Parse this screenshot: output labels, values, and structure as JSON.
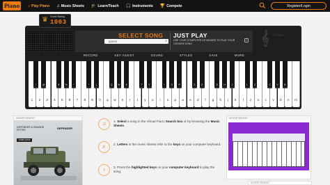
{
  "header": {
    "logo_text": "Piano",
    "nav": [
      {
        "label": "Play Piano",
        "icon": "piano-icon",
        "glyph": "♪",
        "active": true
      },
      {
        "label": "Music Sheets",
        "icon": "music-note-icon",
        "glyph": "♫",
        "active": false
      },
      {
        "label": "Learn/Teach",
        "icon": "graduation-cap-icon",
        "glyph": "🎓",
        "active": false
      },
      {
        "label": "Instruments",
        "icon": "headphones-icon",
        "glyph": "🎧",
        "active": false
      },
      {
        "label": "Compete",
        "icon": "trophy-icon",
        "glyph": "🏆",
        "active": false
      }
    ],
    "login_label": "Register/Login",
    "accent_color": "#e87a12"
  },
  "piano": {
    "rating_label": "Guest Rating",
    "rating_value": "1003",
    "select_song_title": "SELECT SONG",
    "search_value": "queen",
    "just_play_title": "JUST PLAY",
    "just_play_desc": "USE YOUR COMPUTER KEYBOARD TO PLAY YOUR CHOSEN SONG",
    "brand_text": "Piano",
    "toolbar": [
      "RECORD",
      "KEY ASSIST",
      "SOUND",
      "STYLES",
      "SAVE",
      "MORE"
    ],
    "white_keys": [
      "1",
      "2",
      "3",
      "4",
      "5",
      "6",
      "7",
      "8",
      "9",
      "0",
      "q",
      "w",
      "e",
      "r",
      "t",
      "y",
      "u",
      "i",
      "o",
      "p",
      "a",
      "s",
      "d",
      "f",
      "g",
      "h",
      "j",
      "k",
      "l",
      "z",
      "x",
      "c",
      "v",
      "b",
      "n",
      "m"
    ],
    "black_keys": [
      {
        "after": 0,
        "label": "!"
      },
      {
        "after": 1,
        "label": "@"
      },
      {
        "after": 3,
        "label": "$"
      },
      {
        "after": 4,
        "label": "%"
      },
      {
        "after": 5,
        "label": "^"
      },
      {
        "after": 7,
        "label": "*"
      },
      {
        "after": 8,
        "label": "("
      },
      {
        "after": 10,
        "label": "Q"
      },
      {
        "after": 11,
        "label": "W"
      },
      {
        "after": 12,
        "label": "E"
      },
      {
        "after": 14,
        "label": "T"
      },
      {
        "after": 15,
        "label": "Y"
      },
      {
        "after": 17,
        "label": "I"
      },
      {
        "after": 18,
        "label": "O"
      },
      {
        "after": 19,
        "label": "P"
      },
      {
        "after": 21,
        "label": "S"
      },
      {
        "after": 22,
        "label": "D"
      },
      {
        "after": 24,
        "label": "G"
      },
      {
        "after": 25,
        "label": "H"
      },
      {
        "after": 26,
        "label": "J"
      },
      {
        "after": 28,
        "label": "L"
      },
      {
        "after": 29,
        "label": "Z"
      },
      {
        "after": 31,
        "label": "C"
      },
      {
        "after": 32,
        "label": "V"
      },
      {
        "after": 33,
        "label": "B"
      }
    ]
  },
  "ads": {
    "left_label": "ADVERTISEMENT",
    "left_text": "DEFENDER A GRANDE FEITER",
    "left_brand": "DEFENDER",
    "left_button": "SAIBA MAIS",
    "right_label": "ADVERTISEMENT",
    "right2_label": "ADVERTISEMENT"
  },
  "steps": [
    {
      "num": "1.",
      "icon": "headphone-icon",
      "glyph": "♫",
      "parts": [
        [
          "Select",
          true
        ],
        [
          " a song in the Virtual Piano ",
          false
        ],
        [
          "Search box",
          true
        ],
        [
          " or by browsing the ",
          false
        ],
        [
          "Music Sheets",
          true
        ],
        [
          ".",
          false
        ]
      ]
    },
    {
      "num": "2.",
      "icon": "music-notes-icon",
      "glyph": "♬",
      "parts": [
        [
          "Letters",
          true
        ],
        [
          " in the music sheets refer to the ",
          false
        ],
        [
          "keys",
          true
        ],
        [
          " on your computer keyboard.",
          false
        ]
      ]
    },
    {
      "num": "3.",
      "icon": "keyboard-icon",
      "glyph": "♪",
      "parts": [
        [
          "Press the ",
          false
        ],
        [
          "highlighted keys",
          true
        ],
        [
          " on your ",
          false
        ],
        [
          "computer keyboard",
          true
        ],
        [
          " to play the song.",
          false
        ]
      ]
    }
  ]
}
